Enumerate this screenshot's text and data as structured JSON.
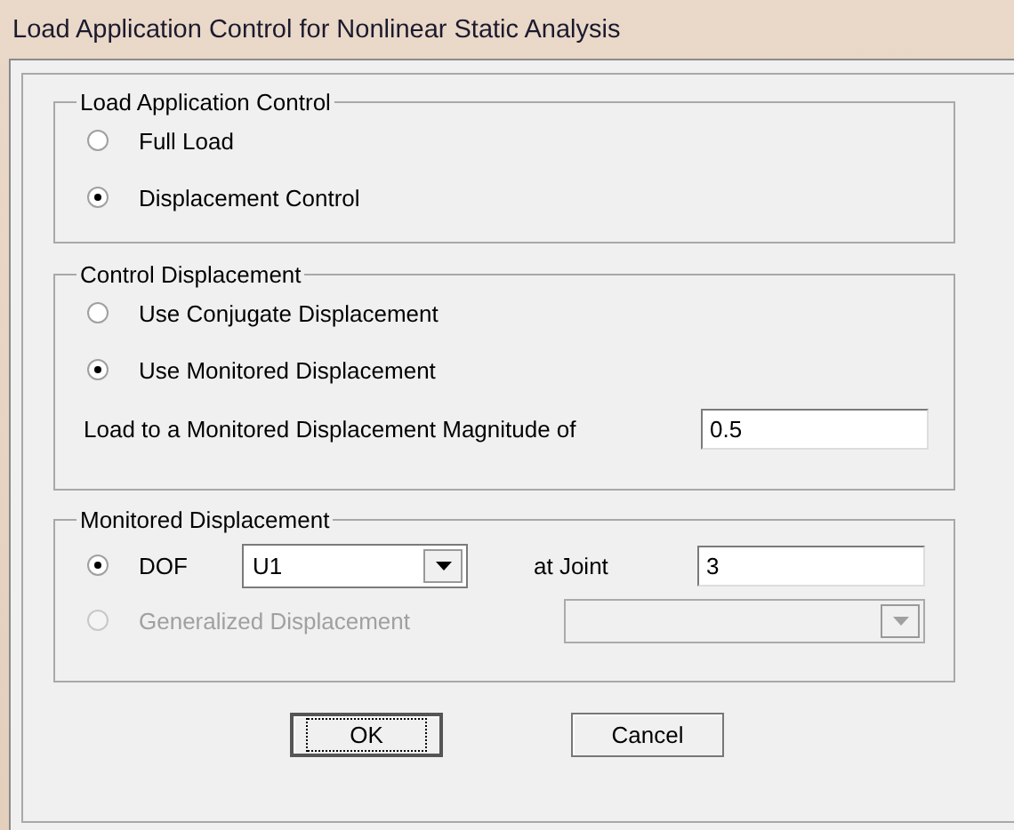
{
  "window": {
    "title": "Load Application Control for Nonlinear Static Analysis"
  },
  "load_application_control": {
    "title": "Load Application Control",
    "options": [
      {
        "label": "Full Load",
        "selected": false
      },
      {
        "label": "Displacement Control",
        "selected": true
      }
    ]
  },
  "control_displacement": {
    "title": "Control Displacement",
    "options": [
      {
        "label": "Use Conjugate Displacement",
        "selected": false
      },
      {
        "label": "Use Monitored Displacement",
        "selected": true
      }
    ],
    "magnitude": {
      "label": "Load to a Monitored Displacement Magnitude of",
      "value": "0.5"
    }
  },
  "monitored_displacement": {
    "title": "Monitored Displacement",
    "dof": {
      "label": "DOF",
      "selected": true,
      "disabled": false,
      "value": "U1"
    },
    "joint": {
      "label": "at Joint",
      "value": "3"
    },
    "generalized": {
      "label": "Generalized Displacement",
      "selected": false,
      "disabled": true
    }
  },
  "buttons": [
    {
      "label": "OK",
      "focused": true
    },
    {
      "label": "Cancel",
      "focused": false
    }
  ]
}
